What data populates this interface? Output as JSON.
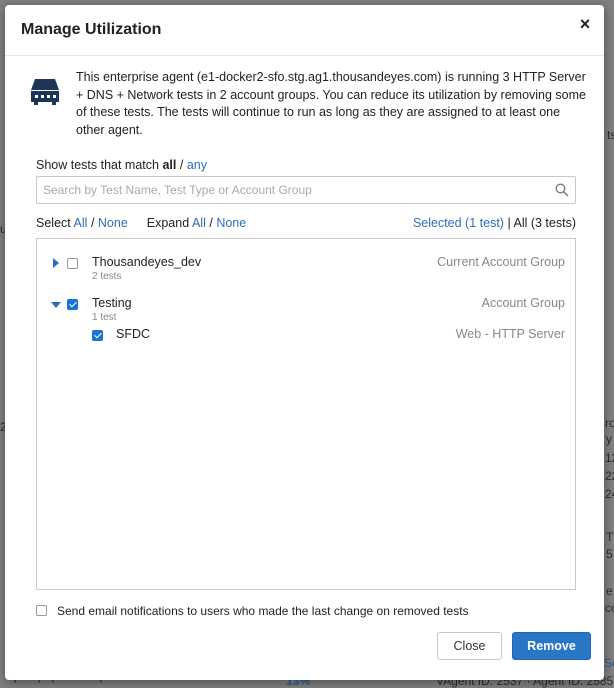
{
  "background": {
    "fragments": [
      {
        "text": "ts",
        "side": "right"
      },
      {
        "text": "ro",
        "side": "right"
      },
      {
        "text": "y",
        "side": "right"
      },
      {
        "text": "12",
        "side": "right"
      },
      {
        "text": "22",
        "side": "right"
      },
      {
        "text": "24",
        "side": "right"
      },
      {
        "text": "T",
        "side": "right"
      },
      {
        "text": "5",
        "side": "right"
      },
      {
        "text": "e",
        "side": "right"
      },
      {
        "text": "co",
        "side": "right"
      },
      {
        "text": "2",
        "side": "left"
      },
      {
        "text": "us",
        "side": "left"
      }
    ],
    "bottom_percent": "13%",
    "bottom_agent": "VAgent ID: 2537 · Agent ID: 2585",
    "bottom_link": "Se"
  },
  "modal": {
    "title": "Manage Utilization",
    "close_glyph": "×",
    "intro": "This enterprise agent (e1-docker2-sfo.stg.ag1.thousandeyes.com) is running 3 HTTP Server + DNS + Network tests in 2 account groups. You can reduce its utilization by removing some of these tests. The tests will continue to run as long as they are assigned to at least one other agent.",
    "match_prefix": "Show tests that match",
    "match_all": "all",
    "match_sep": "/",
    "match_any": "any",
    "search_placeholder": "Search by Test Name, Test Type or Account Group",
    "select_label": "Select",
    "select_all": "All",
    "select_sep": "/",
    "select_none": "None",
    "expand_label": "Expand",
    "expand_all": "All",
    "expand_sep": "/",
    "expand_none": "None",
    "selected_link": "Selected (1 test)",
    "filter_sep": "|",
    "all_tests": "All (3 tests)",
    "groups": [
      {
        "name": "Thousandeyes_dev",
        "sub": "2 tests",
        "type": "Current Account Group",
        "expanded": false,
        "checked": false
      },
      {
        "name": "Testing",
        "sub": "1 test",
        "type": "Account Group",
        "expanded": true,
        "checked": true
      }
    ],
    "tests": [
      {
        "name": "SFDC",
        "type": "Web - HTTP Server",
        "checked": true
      }
    ],
    "notify_label": "Send email notifications to users who made the last change on removed tests",
    "close_button": "Close",
    "remove_button": "Remove"
  },
  "colors": {
    "accent": "#2a76c6",
    "link": "#2a6ebb",
    "checkbox": "#1a73d6"
  }
}
